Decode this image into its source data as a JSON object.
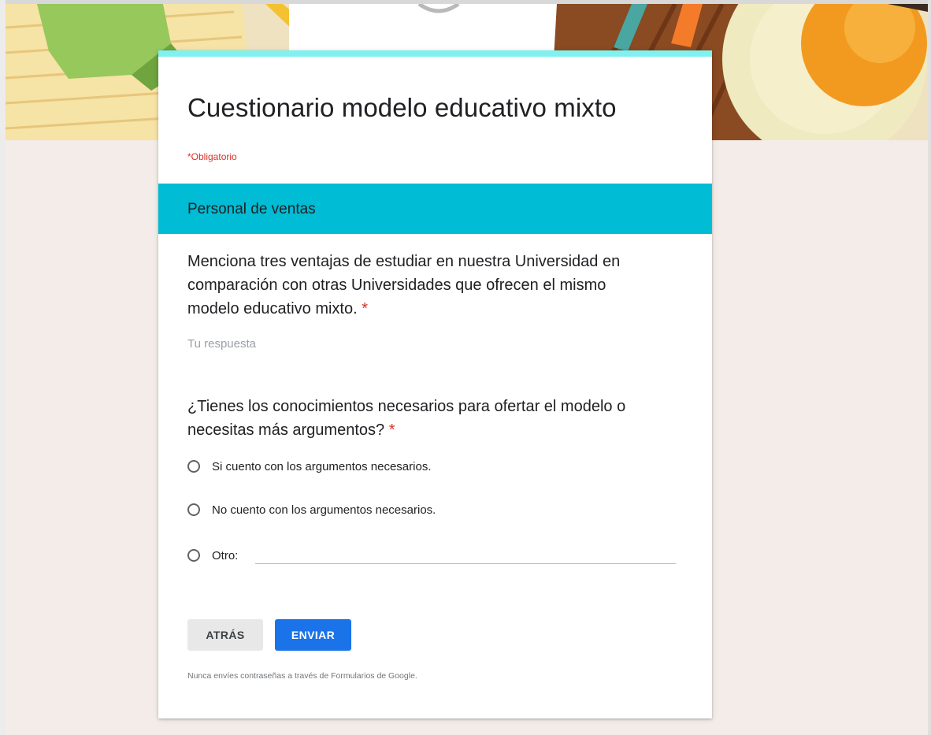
{
  "form": {
    "title": "Cuestionario modelo educativo mixto",
    "required_note": "*Obligatorio",
    "accent_color": "#80f1ee",
    "section_color": "#00bcd4"
  },
  "section": {
    "title": "Personal de ventas"
  },
  "question1": {
    "text": "Menciona tres ventajas de estudiar en nuestra Universidad en comparación con otras Universidades que ofrecen el mismo modelo educativo mixto.",
    "required_mark": "*",
    "placeholder": "Tu respuesta"
  },
  "question2": {
    "text": "¿Tienes los conocimientos necesarios para ofertar el modelo o necesitas más argumentos?",
    "required_mark": "*",
    "options": [
      {
        "label": "Si cuento con los argumentos necesarios."
      },
      {
        "label": "No cuento con los argumentos necesarios."
      },
      {
        "label": "Otro:"
      }
    ]
  },
  "buttons": {
    "back_label": "ATRÁS",
    "send_label": "ENVIAR",
    "send_color": "#1a73e8"
  },
  "footer": {
    "note": "Nunca envíes contraseñas a través de Formularios de Google."
  }
}
